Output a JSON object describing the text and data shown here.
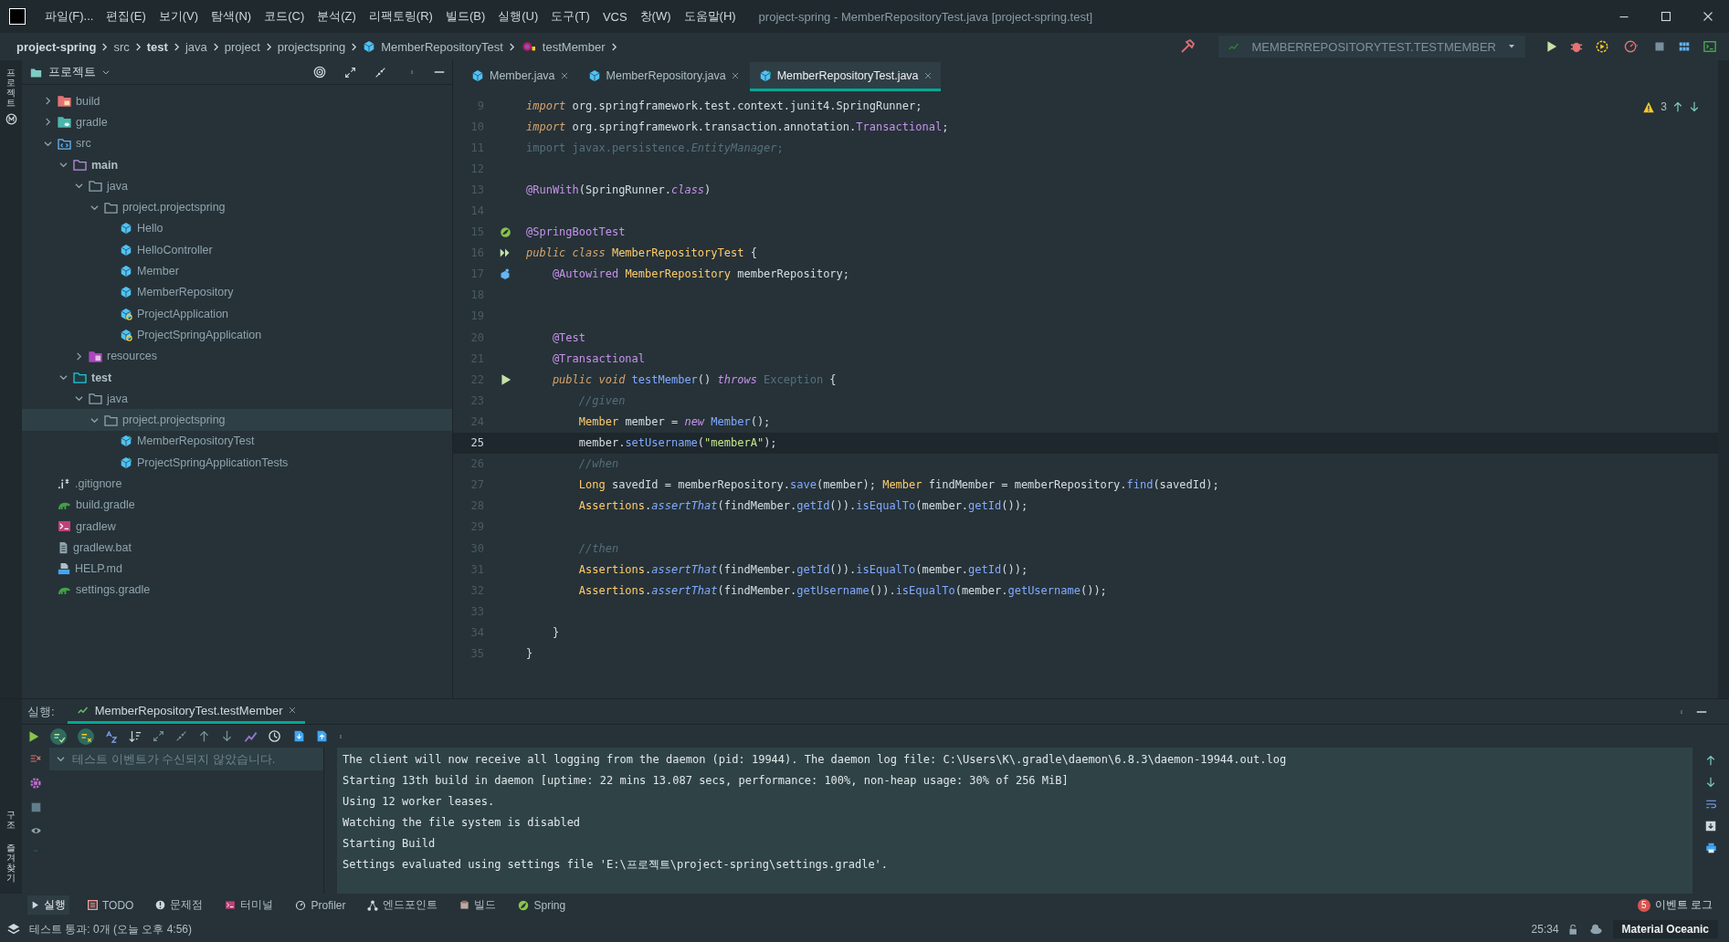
{
  "window": {
    "title": "project-spring - MemberRepositoryTest.java [project-spring.test]"
  },
  "menu": [
    "파일(F)...",
    "편집(E)",
    "보기(V)",
    "탐색(N)",
    "코드(C)",
    "분석(Z)",
    "리팩토링(R)",
    "빌드(B)",
    "실행(U)",
    "도구(T)",
    "VCS",
    "창(W)",
    "도움말(H)"
  ],
  "breadcrumbs": [
    {
      "label": "project-spring",
      "bold": true,
      "kind": "plain"
    },
    {
      "label": "src",
      "bold": false,
      "kind": "plain"
    },
    {
      "label": "test",
      "bold": true,
      "kind": "plain"
    },
    {
      "label": "java",
      "bold": false,
      "kind": "plain"
    },
    {
      "label": "project",
      "bold": false,
      "kind": "plain"
    },
    {
      "label": "projectspring",
      "bold": false,
      "kind": "plain"
    },
    {
      "label": "MemberRepositoryTest",
      "bold": false,
      "kind": "class"
    },
    {
      "label": "testMember",
      "bold": false,
      "kind": "method"
    }
  ],
  "run_config": {
    "label": "MEMBERREPOSITORYTEST.TESTMEMBER"
  },
  "left_strip": {
    "top": [
      "프로젝트"
    ],
    "bottom": [
      "구조",
      "즐겨찾기"
    ]
  },
  "project_panel": {
    "title": "프로젝트",
    "tree": [
      {
        "label": "build",
        "kind": "folder-excluded",
        "expanded": false,
        "selected": false,
        "bold": false
      },
      {
        "label": "gradle",
        "kind": "folder-gradle",
        "expanded": false,
        "selected": false,
        "bold": false
      },
      {
        "label": "src",
        "kind": "folder-source",
        "expanded": true,
        "selected": false,
        "bold": false,
        "children": [
          {
            "label": "main",
            "kind": "folder-main",
            "expanded": true,
            "selected": false,
            "bold": true,
            "children": [
              {
                "label": "java",
                "kind": "folder",
                "expanded": true,
                "selected": false,
                "bold": false,
                "children": [
                  {
                    "label": "project.projectspring",
                    "kind": "folder",
                    "expanded": true,
                    "selected": false,
                    "bold": false,
                    "children": [
                      {
                        "label": "Hello",
                        "kind": "class",
                        "selected": false,
                        "bold": false
                      },
                      {
                        "label": "HelloController",
                        "kind": "class",
                        "selected": false,
                        "bold": false
                      },
                      {
                        "label": "Member",
                        "kind": "class",
                        "selected": false,
                        "bold": false
                      },
                      {
                        "label": "MemberRepository",
                        "kind": "class",
                        "selected": false,
                        "bold": false
                      },
                      {
                        "label": "ProjectApplication",
                        "kind": "app-class",
                        "selected": false,
                        "bold": false
                      },
                      {
                        "label": "ProjectSpringApplication",
                        "kind": "app-class",
                        "selected": false,
                        "bold": false
                      }
                    ]
                  }
                ]
              },
              {
                "label": "resources",
                "kind": "folder-resources",
                "expanded": false,
                "selected": false,
                "bold": false
              }
            ]
          },
          {
            "label": "test",
            "kind": "folder-test",
            "expanded": true,
            "selected": false,
            "bold": true,
            "children": [
              {
                "label": "java",
                "kind": "folder",
                "expanded": true,
                "selected": false,
                "bold": false,
                "children": [
                  {
                    "label": "project.projectspring",
                    "kind": "folder",
                    "expanded": true,
                    "selected": true,
                    "bold": false,
                    "children": [
                      {
                        "label": "MemberRepositoryTest",
                        "kind": "test-class",
                        "selected": false,
                        "bold": false
                      },
                      {
                        "label": "ProjectSpringApplicationTests",
                        "kind": "test-class",
                        "selected": false,
                        "bold": false
                      }
                    ]
                  }
                ]
              }
            ]
          }
        ]
      },
      {
        "label": ".gitignore",
        "kind": "ignore",
        "selected": false,
        "bold": false
      },
      {
        "label": "build.gradle",
        "kind": "gradle",
        "selected": false,
        "bold": false
      },
      {
        "label": "gradlew",
        "kind": "script",
        "selected": false,
        "bold": false
      },
      {
        "label": "gradlew.bat",
        "kind": "bat",
        "selected": false,
        "bold": false
      },
      {
        "label": "HELP.md",
        "kind": "md",
        "selected": false,
        "bold": false
      },
      {
        "label": "settings.gradle",
        "kind": "gradle",
        "selected": false,
        "bold": false
      }
    ]
  },
  "editor": {
    "tabs": [
      {
        "label": "Member.java",
        "selected": false
      },
      {
        "label": "MemberRepository.java",
        "selected": false
      },
      {
        "label": "MemberRepositoryTest.java",
        "selected": true
      }
    ],
    "warnings": "3",
    "lines": [
      {
        "number": "9",
        "current": false,
        "kind": "plain",
        "tokens": [
          {
            "kind": "kw",
            "text": "import"
          },
          {
            "kind": "plain",
            "text": " org.springframework.test.context.junit4.SpringRunner;"
          }
        ]
      },
      {
        "number": "10",
        "current": false,
        "kind": "plain",
        "tokens": [
          {
            "kind": "kw",
            "text": "import"
          },
          {
            "kind": "plain",
            "text": " org.springframework.transaction.annotation."
          },
          {
            "kind": "ann",
            "text": "Transactional"
          },
          {
            "kind": "plain",
            "text": ";"
          }
        ]
      },
      {
        "number": "11",
        "current": false,
        "kind": "plain",
        "tokens": [
          {
            "kind": "dim",
            "text": "import javax.persistence."
          },
          {
            "kind": "dimi",
            "text": "EntityManager"
          },
          {
            "kind": "dim",
            "text": ";"
          }
        ]
      },
      {
        "number": "12",
        "current": false,
        "kind": "plain"
      },
      {
        "number": "13",
        "current": false,
        "kind": "plain",
        "tokens": [
          {
            "kind": "ann",
            "text": "@RunWith"
          },
          {
            "kind": "plain",
            "text": "(SpringRunner."
          },
          {
            "kind": "kwp",
            "text": "class"
          },
          {
            "kind": "plain",
            "text": ")"
          }
        ]
      },
      {
        "number": "14",
        "current": false,
        "kind": "plain"
      },
      {
        "number": "15",
        "current": false,
        "kind": "spring",
        "tokens": [
          {
            "kind": "ann",
            "text": "@SpringBootTest"
          }
        ]
      },
      {
        "number": "16",
        "current": false,
        "kind": "run-all",
        "tokens": [
          {
            "kind": "kw",
            "text": "public class "
          },
          {
            "kind": "type",
            "text": "MemberRepositoryTest"
          },
          {
            "kind": "plain",
            "text": " {"
          }
        ]
      },
      {
        "number": "17",
        "current": false,
        "kind": "bean",
        "tokens": [
          {
            "kind": "ann",
            "text": "    @Autowired"
          },
          {
            "kind": "type",
            "text": " MemberRepository"
          },
          {
            "kind": "plain",
            "text": " memberRepository;"
          }
        ]
      },
      {
        "number": "18",
        "current": false,
        "kind": "plain"
      },
      {
        "number": "19",
        "current": false,
        "kind": "plain"
      },
      {
        "number": "20",
        "current": false,
        "kind": "plain",
        "tokens": [
          {
            "kind": "ann",
            "text": "    @Test"
          }
        ]
      },
      {
        "number": "21",
        "current": false,
        "kind": "plain",
        "tokens": [
          {
            "kind": "ann",
            "text": "    @Transactional"
          }
        ]
      },
      {
        "number": "22",
        "current": false,
        "kind": "run",
        "tokens": [
          {
            "kind": "kw",
            "text": "    public void "
          },
          {
            "kind": "fn",
            "text": "testMember"
          },
          {
            "kind": "plain",
            "text": "() "
          },
          {
            "kind": "kwp",
            "text": "throws"
          },
          {
            "kind": "dim",
            "text": " Exception"
          },
          {
            "kind": "plain",
            "text": " {"
          }
        ]
      },
      {
        "number": "23",
        "current": false,
        "kind": "plain",
        "tokens": [
          {
            "kind": "cmt",
            "text": "        //given"
          }
        ]
      },
      {
        "number": "24",
        "current": false,
        "kind": "plain",
        "tokens": [
          {
            "kind": "type",
            "text": "        Member"
          },
          {
            "kind": "plain",
            "text": " member = "
          },
          {
            "kind": "kwp",
            "text": "new"
          },
          {
            "kind": "fn",
            "text": " Member"
          },
          {
            "kind": "plain",
            "text": "();"
          }
        ]
      },
      {
        "number": "25",
        "current": true,
        "kind": "plain",
        "tokens": [
          {
            "kind": "plain",
            "text": "        member."
          },
          {
            "kind": "fn",
            "text": "setUsername"
          },
          {
            "kind": "plain",
            "text": "("
          },
          {
            "kind": "str",
            "text": "\"memberA\""
          },
          {
            "kind": "plain",
            "text": ");"
          }
        ]
      },
      {
        "number": "26",
        "current": false,
        "kind": "plain",
        "tokens": [
          {
            "kind": "cmt",
            "text": "        //when"
          }
        ]
      },
      {
        "number": "27",
        "current": false,
        "kind": "plain",
        "tokens": [
          {
            "kind": "type",
            "text": "        Long"
          },
          {
            "kind": "plain",
            "text": " savedId = memberRepository."
          },
          {
            "kind": "fn",
            "text": "save"
          },
          {
            "kind": "plain",
            "text": "(member); "
          },
          {
            "kind": "type",
            "text": "Member"
          },
          {
            "kind": "plain",
            "text": " findMember = memberRepository."
          },
          {
            "kind": "fn",
            "text": "find"
          },
          {
            "kind": "plain",
            "text": "(savedId);"
          }
        ]
      },
      {
        "number": "28",
        "current": false,
        "kind": "plain",
        "tokens": [
          {
            "kind": "type",
            "text": "        Assertions"
          },
          {
            "kind": "plain",
            "text": "."
          },
          {
            "kind": "fni",
            "text": "assertThat"
          },
          {
            "kind": "plain",
            "text": "(findMember."
          },
          {
            "kind": "fn",
            "text": "getId"
          },
          {
            "kind": "plain",
            "text": "())."
          },
          {
            "kind": "fn",
            "text": "isEqualTo"
          },
          {
            "kind": "plain",
            "text": "(member."
          },
          {
            "kind": "fn",
            "text": "getId"
          },
          {
            "kind": "plain",
            "text": "());"
          }
        ]
      },
      {
        "number": "29",
        "current": false,
        "kind": "plain"
      },
      {
        "number": "30",
        "current": false,
        "kind": "plain",
        "tokens": [
          {
            "kind": "cmt",
            "text": "        //then"
          }
        ]
      },
      {
        "number": "31",
        "current": false,
        "kind": "plain",
        "tokens": [
          {
            "kind": "type",
            "text": "        Assertions"
          },
          {
            "kind": "plain",
            "text": "."
          },
          {
            "kind": "fni",
            "text": "assertThat"
          },
          {
            "kind": "plain",
            "text": "(findMember."
          },
          {
            "kind": "fn",
            "text": "getId"
          },
          {
            "kind": "plain",
            "text": "())."
          },
          {
            "kind": "fn",
            "text": "isEqualTo"
          },
          {
            "kind": "plain",
            "text": "(member."
          },
          {
            "kind": "fn",
            "text": "getId"
          },
          {
            "kind": "plain",
            "text": "());"
          }
        ]
      },
      {
        "number": "32",
        "current": false,
        "kind": "plain",
        "tokens": [
          {
            "kind": "type",
            "text": "        Assertions"
          },
          {
            "kind": "plain",
            "text": "."
          },
          {
            "kind": "fni",
            "text": "assertThat"
          },
          {
            "kind": "plain",
            "text": "(findMember."
          },
          {
            "kind": "fn",
            "text": "getUsername"
          },
          {
            "kind": "plain",
            "text": "())."
          },
          {
            "kind": "fn",
            "text": "isEqualTo"
          },
          {
            "kind": "plain",
            "text": "(member."
          },
          {
            "kind": "fn",
            "text": "getUsername"
          },
          {
            "kind": "plain",
            "text": "());"
          }
        ]
      },
      {
        "number": "33",
        "current": false,
        "kind": "plain"
      },
      {
        "number": "34",
        "current": false,
        "kind": "plain",
        "tokens": [
          {
            "kind": "plain",
            "text": "    }"
          }
        ]
      },
      {
        "number": "35",
        "current": false,
        "kind": "plain",
        "tokens": [
          {
            "kind": "plain",
            "text": "}"
          }
        ]
      }
    ]
  },
  "run_panel": {
    "label": "실행:",
    "tab": "MemberRepositoryTest.testMember",
    "test_tree": [
      {
        "label": "테스트 이벤트가 수신되지 않았습니다.",
        "expanded": true
      }
    ],
    "console": [
      "The client will now receive all logging from the daemon (pid: 19944). The daemon log file: C:\\Users\\K\\.gradle\\daemon\\6.8.3\\daemon-19944.out.log",
      "Starting 13th build in daemon [uptime: 22 mins 13.087 secs, performance: 100%, non-heap usage: 30% of 256 MiB]",
      "Using 12 worker leases.",
      "Watching the file system is disabled",
      "Starting Build",
      "Settings evaluated using settings file 'E:\\프로젝트\\project-spring\\settings.gradle'."
    ]
  },
  "tool_buttons": [
    {
      "label": "실행",
      "kind": "run",
      "selected": true
    },
    {
      "label": "TODO",
      "kind": "todo",
      "selected": false
    },
    {
      "label": "문제점",
      "kind": "problems",
      "selected": false
    },
    {
      "label": "터미널",
      "kind": "terminal",
      "selected": false
    },
    {
      "label": "Profiler",
      "kind": "profiler",
      "selected": false
    },
    {
      "label": "엔드포인트",
      "kind": "endpoints",
      "selected": false
    },
    {
      "label": "빌드",
      "kind": "build",
      "selected": false
    },
    {
      "label": "Spring",
      "kind": "spring",
      "selected": false
    }
  ],
  "event_log": {
    "label": "이벤트 로그",
    "count": "5"
  },
  "status_bar": {
    "message": "테스트 통과: 0개 (오늘 오후 4:56)",
    "position": "25:34",
    "theme": "Material Oceanic"
  }
}
